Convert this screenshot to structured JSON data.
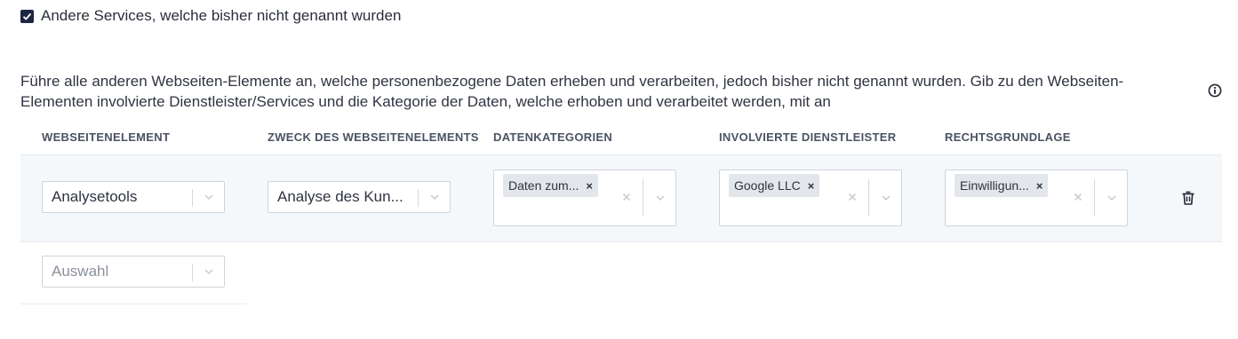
{
  "checkbox": {
    "label": "Andere Services, welche bisher nicht genannt wurden",
    "checked": true
  },
  "description": {
    "line1": "Führe alle anderen Webseiten-Elemente an, welche personenbezogene Daten erheben und verarbeiten, jedoch bisher nicht genannt wurden. Gib zu den Webseiten-",
    "line2": "Elementen involvierte Dienstleister/Services und die Kategorie der Daten, welche erhoben und verarbeitet werden, mit an"
  },
  "columns": {
    "element": "WEBSEITENELEMENT",
    "purpose": "ZWECK DES WEBSEITENELEMENTS",
    "data_categories": "DATENKATEGORIEN",
    "providers": "INVOLVIERTE DIENSTLEISTER",
    "legal_basis": "RECHTSGRUNDLAGE"
  },
  "row": {
    "element": "Analysetools",
    "purpose": "Analyse des Kun...",
    "data_category_tag": "Daten zum...",
    "provider_tag": "Google LLC",
    "legal_basis_tag": "Einwilligun...",
    "tag_remove": "×"
  },
  "new_row": {
    "placeholder": "Auswahl"
  },
  "icons": {
    "checkbox": "check-icon",
    "info": "info-icon",
    "chevron": "chevron-down-icon",
    "clear": "clear-icon",
    "delete": "trash-icon"
  },
  "colors": {
    "checkbox_bg": "#1c2541",
    "row_bg": "#f5f8fb",
    "tag_bg": "#e3e6ea"
  }
}
